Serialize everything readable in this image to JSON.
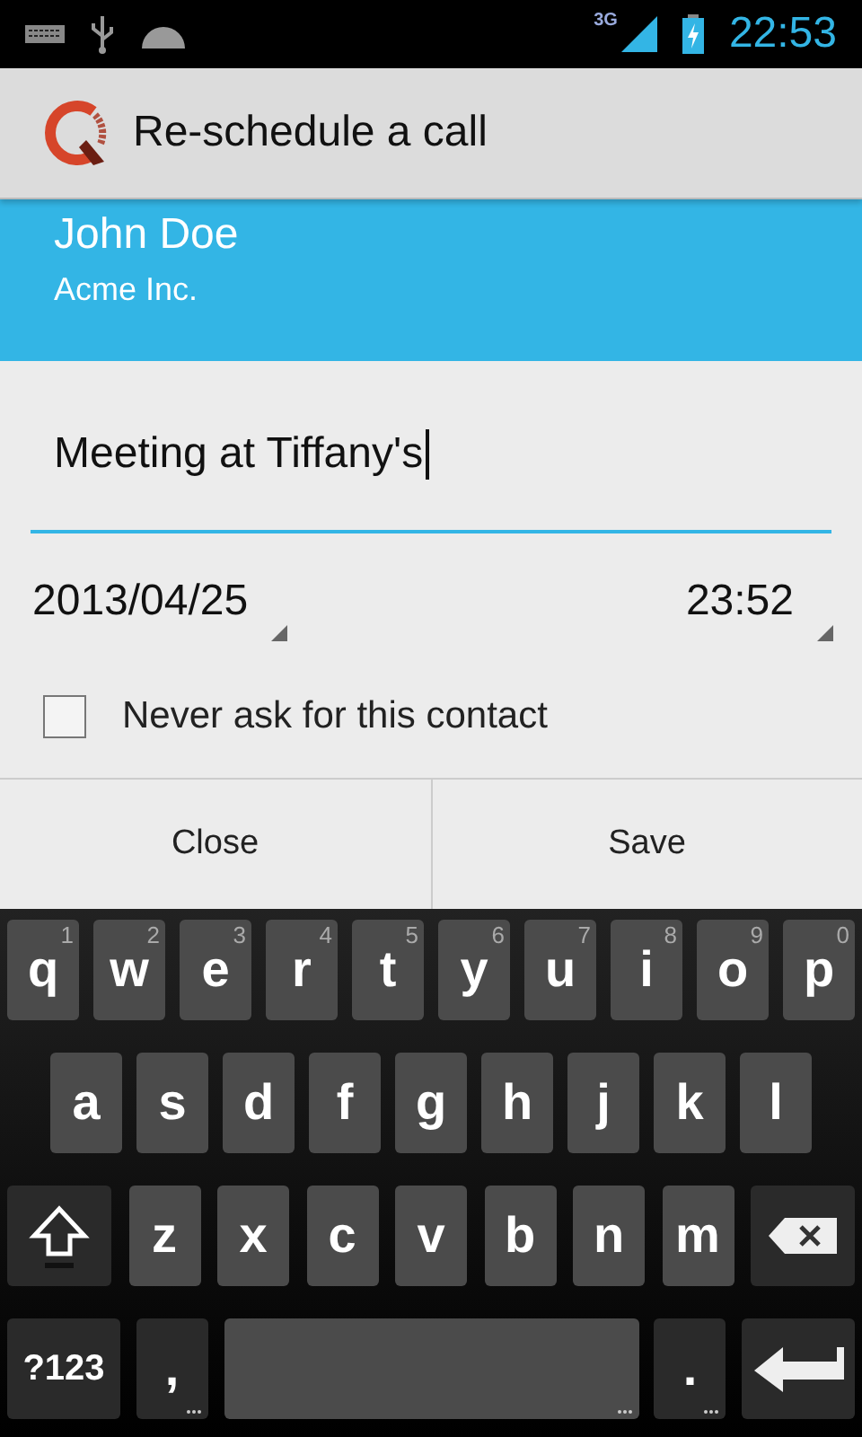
{
  "status_bar": {
    "network": "3G",
    "time": "22:53"
  },
  "action_bar": {
    "title": "Re-schedule a call"
  },
  "contact": {
    "name": "John Doe",
    "company": "Acme Inc."
  },
  "note": {
    "value": "Meeting at Tiffany's",
    "focused": true
  },
  "schedule": {
    "date": "2013/04/25",
    "time": "23:52"
  },
  "never_ask": {
    "label": "Never ask for this contact",
    "checked": false
  },
  "buttons": [
    "Close",
    "Save"
  ],
  "keyboard": {
    "rows": [
      [
        {
          "kind": "char",
          "label": "q",
          "hint": "1"
        },
        {
          "kind": "char",
          "label": "w",
          "hint": "2"
        },
        {
          "kind": "char",
          "label": "e",
          "hint": "3"
        },
        {
          "kind": "char",
          "label": "r",
          "hint": "4"
        },
        {
          "kind": "char",
          "label": "t",
          "hint": "5"
        },
        {
          "kind": "char",
          "label": "y",
          "hint": "6"
        },
        {
          "kind": "char",
          "label": "u",
          "hint": "7"
        },
        {
          "kind": "char",
          "label": "i",
          "hint": "8"
        },
        {
          "kind": "char",
          "label": "o",
          "hint": "9"
        },
        {
          "kind": "char",
          "label": "p",
          "hint": "0"
        }
      ],
      [
        {
          "kind": "char",
          "label": "a"
        },
        {
          "kind": "char",
          "label": "s"
        },
        {
          "kind": "char",
          "label": "d"
        },
        {
          "kind": "char",
          "label": "f"
        },
        {
          "kind": "char",
          "label": "g"
        },
        {
          "kind": "char",
          "label": "h"
        },
        {
          "kind": "char",
          "label": "j"
        },
        {
          "kind": "char",
          "label": "k"
        },
        {
          "kind": "char",
          "label": "l"
        }
      ],
      [
        {
          "kind": "shift"
        },
        {
          "kind": "char",
          "label": "z"
        },
        {
          "kind": "char",
          "label": "x"
        },
        {
          "kind": "char",
          "label": "c"
        },
        {
          "kind": "char",
          "label": "v"
        },
        {
          "kind": "char",
          "label": "b"
        },
        {
          "kind": "char",
          "label": "n"
        },
        {
          "kind": "char",
          "label": "m"
        },
        {
          "kind": "backspace"
        }
      ]
    ],
    "bottom_row": [
      {
        "kind": "symbols",
        "label": "?123"
      },
      {
        "kind": "punct",
        "label": ","
      },
      {
        "kind": "space"
      },
      {
        "kind": "punct",
        "label": "."
      },
      {
        "kind": "enter"
      }
    ]
  }
}
